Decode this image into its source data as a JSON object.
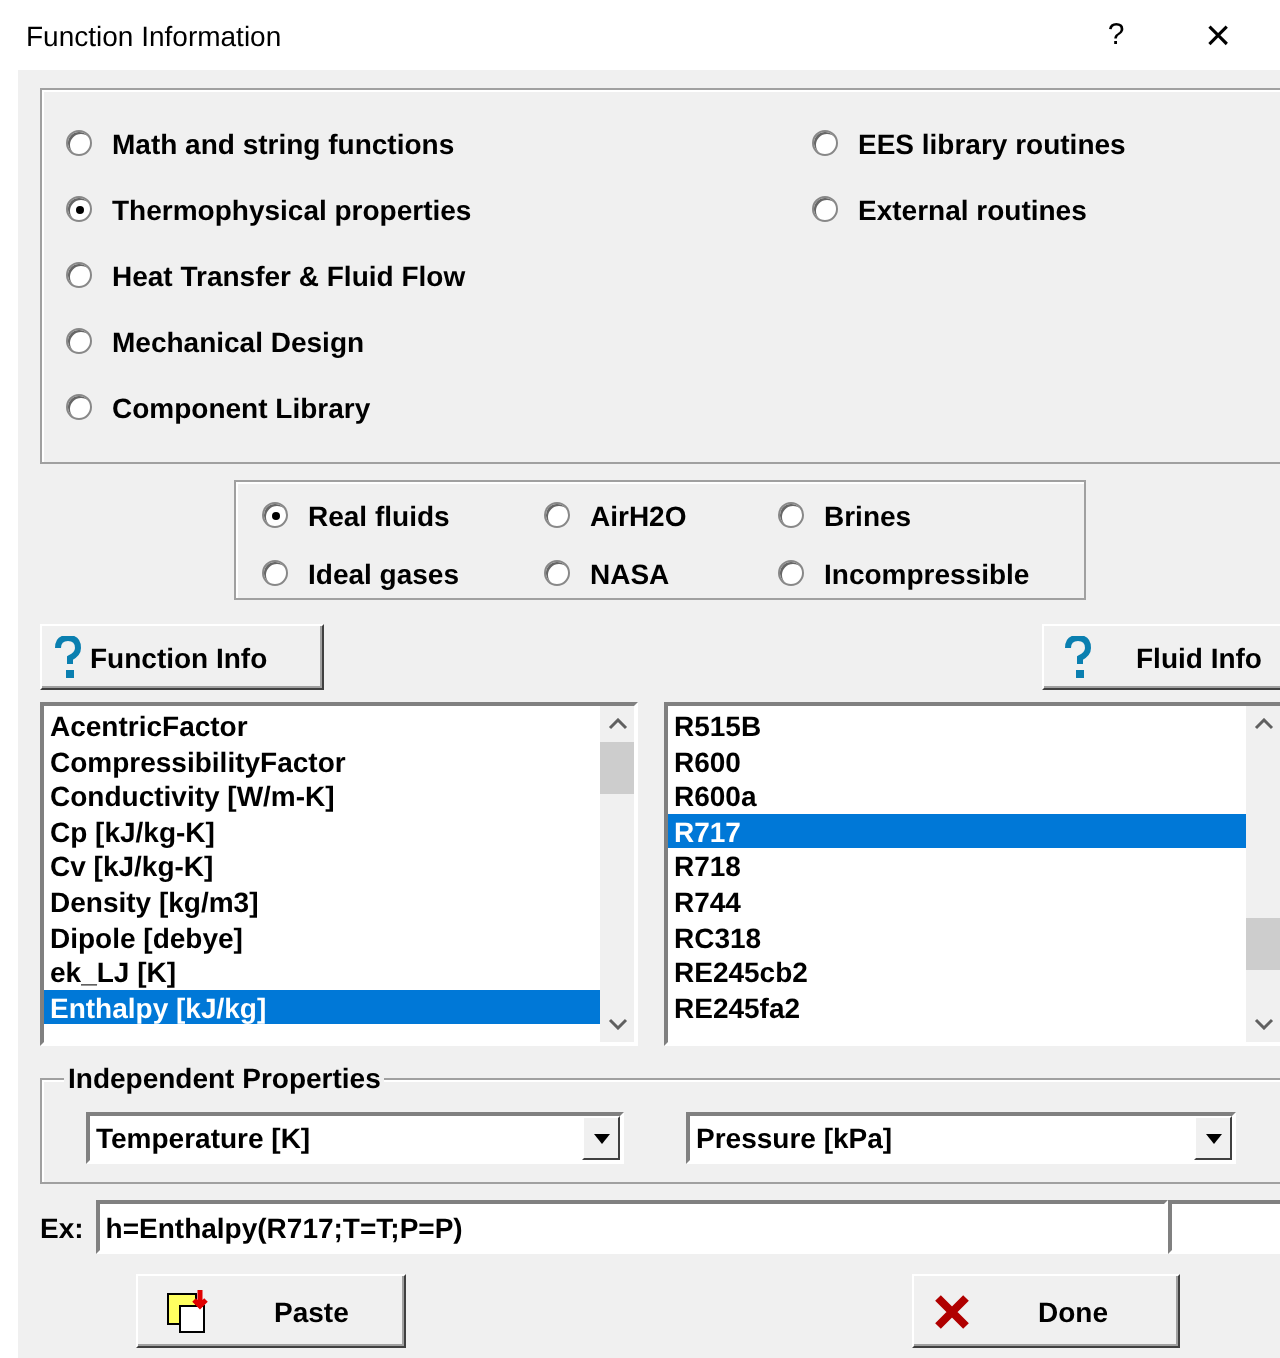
{
  "window": {
    "title": "Function Information",
    "help": "?",
    "close": "×"
  },
  "categories": [
    {
      "label": "Math and string functions",
      "selected": false
    },
    {
      "label": "Thermophysical properties",
      "selected": true
    },
    {
      "label": "Heat Transfer & Fluid Flow",
      "selected": false
    },
    {
      "label": "Mechanical Design",
      "selected": false
    },
    {
      "label": "Component Library",
      "selected": false
    },
    {
      "label": "EES library routines",
      "selected": false
    },
    {
      "label": "External routines",
      "selected": false
    }
  ],
  "fluid_types": [
    {
      "label": "Real fluids",
      "selected": true
    },
    {
      "label": "AirH2O",
      "selected": false
    },
    {
      "label": "Brines",
      "selected": false
    },
    {
      "label": "Ideal gases",
      "selected": false
    },
    {
      "label": "NASA",
      "selected": false
    },
    {
      "label": "Incompressible",
      "selected": false
    }
  ],
  "function_info_button": "Function Info",
  "fluid_info_button": "Fluid Info",
  "functions": [
    {
      "label": "AcentricFactor",
      "selected": false
    },
    {
      "label": "CompressibilityFactor",
      "selected": false
    },
    {
      "label": "Conductivity [W/m-K]",
      "selected": false
    },
    {
      "label": "Cp [kJ/kg-K]",
      "selected": false
    },
    {
      "label": "Cv [kJ/kg-K]",
      "selected": false
    },
    {
      "label": "Density [kg/m3]",
      "selected": false
    },
    {
      "label": "Dipole [debye]",
      "selected": false
    },
    {
      "label": "ek_LJ [K]",
      "selected": false
    },
    {
      "label": "Enthalpy [kJ/kg]",
      "selected": true
    }
  ],
  "fluids": [
    {
      "label": "R515B",
      "selected": false
    },
    {
      "label": "R600",
      "selected": false
    },
    {
      "label": "R600a",
      "selected": false
    },
    {
      "label": "R717",
      "selected": true
    },
    {
      "label": "R718",
      "selected": false
    },
    {
      "label": "R744",
      "selected": false
    },
    {
      "label": "RC318",
      "selected": false
    },
    {
      "label": "RE245cb2",
      "selected": false
    },
    {
      "label": "RE245fa2",
      "selected": false
    }
  ],
  "independent_properties": {
    "title": "Independent Properties",
    "first": "Temperature [K]",
    "second": "Pressure [kPa]"
  },
  "example": {
    "label": "Ex:",
    "value": "h=Enthalpy(R717;T=T;P=P)"
  },
  "buttons": {
    "paste": "Paste",
    "done": "Done"
  }
}
